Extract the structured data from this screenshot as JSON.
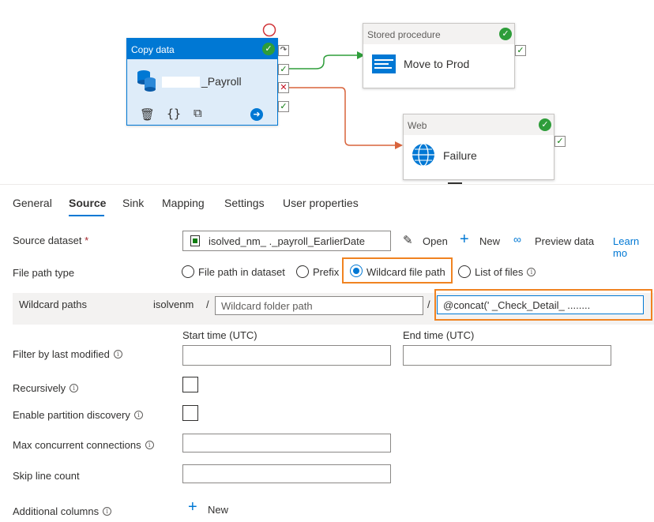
{
  "canvas": {
    "copy": {
      "type": "Copy data",
      "name": "_Payroll"
    },
    "stored": {
      "type": "Stored procedure",
      "name": "Move to Prod"
    },
    "web": {
      "type": "Web",
      "name": "Failure"
    }
  },
  "tabs": [
    "General",
    "Source",
    "Sink",
    "Mapping",
    "Settings",
    "User properties"
  ],
  "active_tab": "Source",
  "source": {
    "dataset_label": "Source dataset",
    "required_mark": "*",
    "dataset_value": "isolved_nm_        ._payroll_EarlierDate",
    "open": "Open",
    "new": "New",
    "preview": "Preview data",
    "learn": "Learn mo",
    "file_path_type_label": "File path type",
    "options": [
      "File path in dataset",
      "Prefix",
      "Wildcard file path",
      "List of files"
    ],
    "selected_option": "Wildcard file path",
    "wildcard_label": "Wildcard paths",
    "container": "isolvenm",
    "slash": "/",
    "folder_placeholder": "Wildcard folder path",
    "file_value": "@concat('         _Check_Detail_ ........",
    "start_time": "Start time (UTC)",
    "end_time": "End time (UTC)",
    "filter_label": "Filter by last modified",
    "recursively": "Recursively",
    "partition": "Enable partition discovery",
    "max_conn": "Max concurrent connections",
    "skip": "Skip line count",
    "additional": "Additional columns",
    "add_new": "New"
  },
  "icons": [
    "database-icon",
    "stored-procedure-icon",
    "globe-icon",
    "delete-icon",
    "code-icon",
    "copy-icon",
    "arrow-right-icon",
    "check-icon",
    "error-icon",
    "skip-icon",
    "dataset-icon",
    "edit-icon",
    "add-icon",
    "glasses-icon",
    "info-icon"
  ],
  "colors": {
    "accent": "#0078d4",
    "success": "#2e9d3a",
    "failure_arrow": "#d8643c",
    "highlight": "#f08321"
  }
}
